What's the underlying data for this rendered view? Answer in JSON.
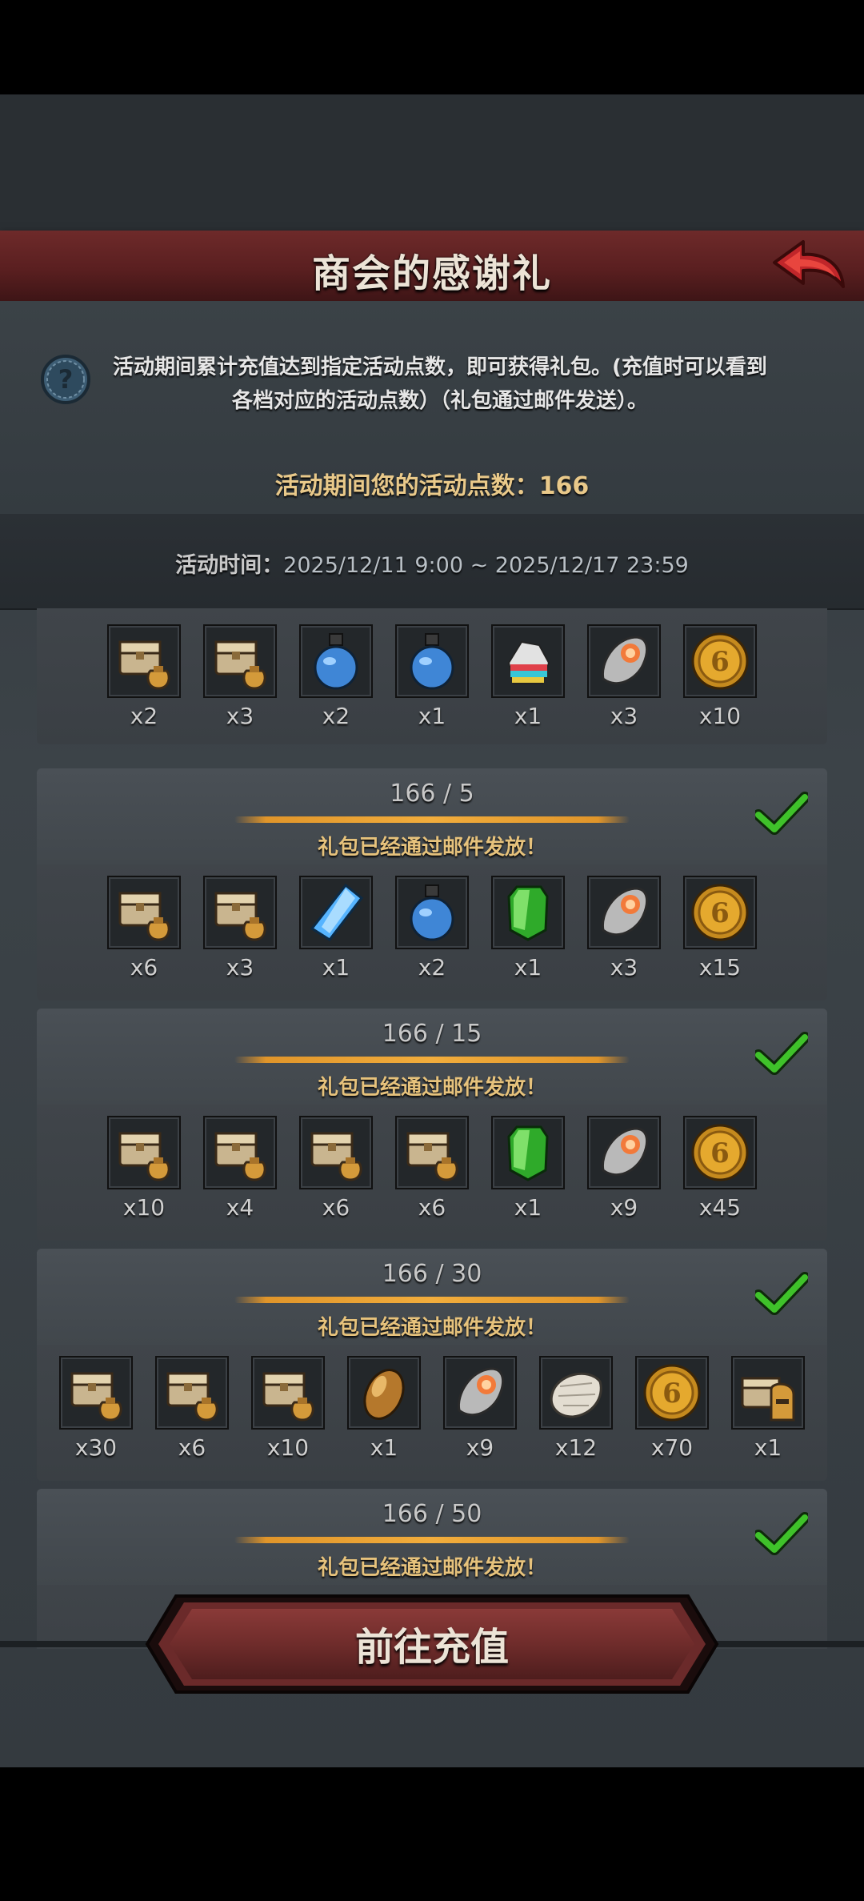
{
  "header": {
    "title": "商会的感谢礼",
    "back_icon": "back-arrow-icon"
  },
  "info": {
    "description": "活动期间累计充值达到指定活动点数，即可获得礼包。(充值时可以看到各档对应的活动点数）（礼包通过邮件发送）。",
    "points_label": "活动期间您的活动点数：",
    "points_value": "166"
  },
  "time": {
    "label": "活动时间：",
    "value": "2025/12/11 9:00 ~ 2025/12/17 23:59"
  },
  "tiers": [
    {
      "progress": "",
      "status": "礼包已经通过邮件发放！",
      "claimed": true,
      "items": [
        {
          "icon": "chest-icon",
          "count": "x2"
        },
        {
          "icon": "chest-icon",
          "count": "x3"
        },
        {
          "icon": "blue-potion-icon",
          "count": "x2"
        },
        {
          "icon": "blue-potion-icon",
          "count": "x1"
        },
        {
          "icon": "rainbow-crystal-icon",
          "count": "x1"
        },
        {
          "icon": "stone-icon",
          "count": "x3"
        },
        {
          "icon": "gold-coin-icon",
          "count": "x10"
        }
      ]
    },
    {
      "progress": "166 / 5",
      "status": "礼包已经通过邮件发放！",
      "claimed": true,
      "items": [
        {
          "icon": "chest-icon",
          "count": "x6"
        },
        {
          "icon": "chest-icon",
          "count": "x3"
        },
        {
          "icon": "blue-crystal-icon",
          "count": "x1"
        },
        {
          "icon": "blue-potion-icon",
          "count": "x2"
        },
        {
          "icon": "green-gem-icon",
          "count": "x1"
        },
        {
          "icon": "stone-icon",
          "count": "x3"
        },
        {
          "icon": "gold-coin-icon",
          "count": "x15"
        }
      ]
    },
    {
      "progress": "166 / 15",
      "status": "礼包已经通过邮件发放！",
      "claimed": true,
      "items": [
        {
          "icon": "chest-icon",
          "count": "x10"
        },
        {
          "icon": "chest-icon",
          "count": "x4"
        },
        {
          "icon": "chest-icon",
          "count": "x6"
        },
        {
          "icon": "chest-icon",
          "count": "x6"
        },
        {
          "icon": "green-gem-icon",
          "count": "x1"
        },
        {
          "icon": "stone-icon",
          "count": "x9"
        },
        {
          "icon": "gold-coin-icon",
          "count": "x45"
        }
      ]
    },
    {
      "progress": "166 / 30",
      "status": "礼包已经通过邮件发放！",
      "claimed": true,
      "items": [
        {
          "icon": "chest-icon",
          "count": "x30"
        },
        {
          "icon": "chest-icon",
          "count": "x6"
        },
        {
          "icon": "chest-icon",
          "count": "x10"
        },
        {
          "icon": "bronze-egg-icon",
          "count": "x1"
        },
        {
          "icon": "stone-icon",
          "count": "x9"
        },
        {
          "icon": "fur-pelt-icon",
          "count": "x12"
        },
        {
          "icon": "gold-coin-icon",
          "count": "x70"
        },
        {
          "icon": "helmet-chest-icon",
          "count": "x1"
        }
      ]
    },
    {
      "progress": "166 / 50",
      "status": "礼包已经通过邮件发放！",
      "claimed": true,
      "items": []
    }
  ],
  "footer": {
    "button_label": "前往充值"
  },
  "colors": {
    "title_bar": "#5a1f20",
    "accent_gold": "#e6c27c",
    "check_green": "#3fc22a",
    "panel": "#3b4247"
  }
}
